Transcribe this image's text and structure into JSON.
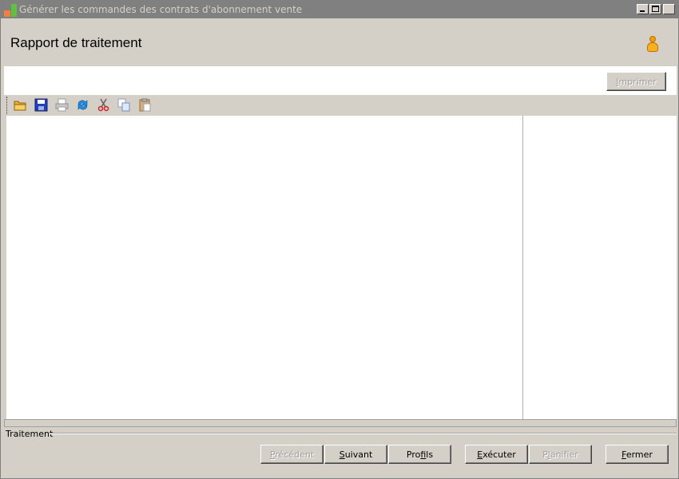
{
  "window": {
    "title": "Générer les commandes des contrats d'abonnement vente"
  },
  "header": {
    "title": "Rapport de traitement"
  },
  "print": {
    "label_u": "I",
    "label_rest": "mprimer"
  },
  "toolbar": {
    "items": [
      "open-folder-icon",
      "save-icon",
      "print-icon",
      "refresh-icon",
      "cut-icon",
      "copy-icon",
      "paste-icon"
    ]
  },
  "group": {
    "label": "Traitement"
  },
  "buttons": {
    "prev": {
      "u": "P",
      "rest": "récédent"
    },
    "next": {
      "u": "S",
      "rest": "uivant"
    },
    "profils": {
      "pre": "Pro",
      "u": "f",
      "rest": "ils"
    },
    "exec": {
      "u": "E",
      "rest": "xécuter"
    },
    "plan": {
      "pre": "P",
      "u": "l",
      "rest": "anifier"
    },
    "close": {
      "u": "F",
      "rest": "ermer"
    }
  },
  "colors": {
    "titlebar": "#808080",
    "face": "#d4d0c8",
    "content": "#ffffff"
  }
}
